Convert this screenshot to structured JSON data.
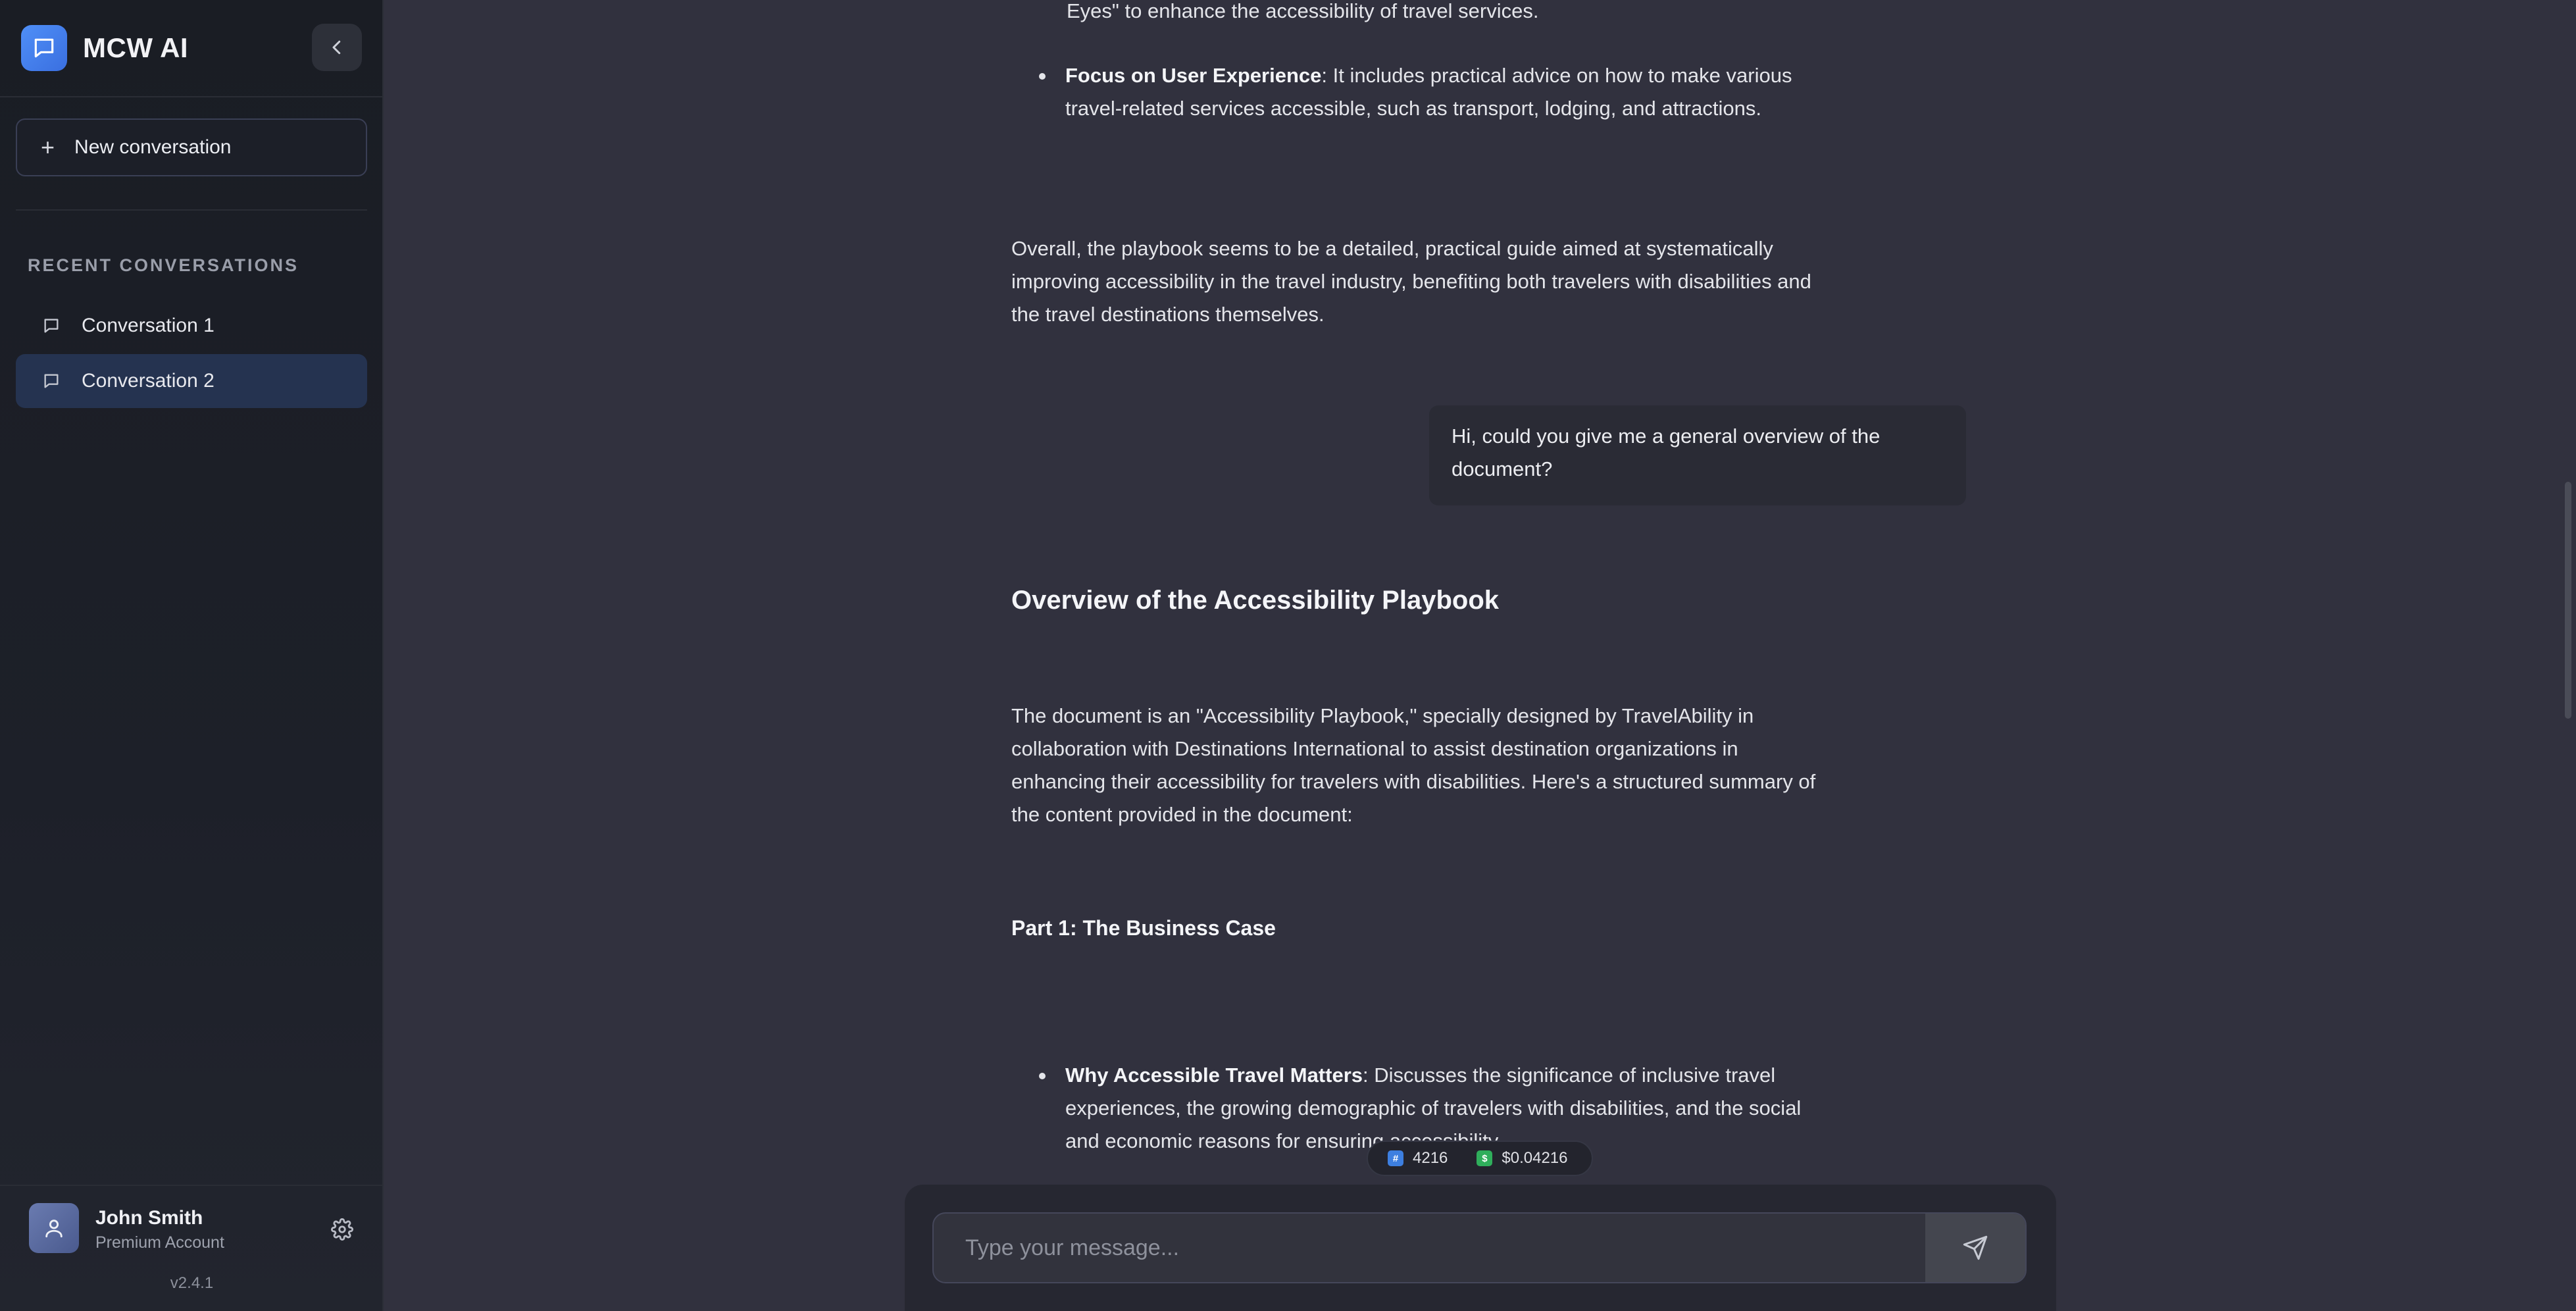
{
  "app": {
    "title": "MCW AI",
    "version": "v2.4.1"
  },
  "sidebar": {
    "new_conversation_label": "New conversation",
    "recent_heading": "RECENT CONVERSATIONS",
    "conversations": [
      {
        "label": "Conversation 1",
        "active": false
      },
      {
        "label": "Conversation 2",
        "active": true
      }
    ],
    "user": {
      "name": "John Smith",
      "plan": "Premium Account"
    }
  },
  "chat": {
    "prev_para_tail": "Eyes\" to enhance the accessibility of travel services.",
    "prev_bullet": {
      "bold": "Focus on User Experience",
      "rest": ": It includes practical advice on how to make various travel-related services accessible, such as transport, lodging, and attractions."
    },
    "prev_summary": "Overall, the playbook seems to be a detailed, practical guide aimed at systematically improving accessibility in the travel industry, benefiting both travelers with disabilities and the travel destinations themselves.",
    "user_message": "Hi, could you give me a general overview of the document?",
    "response": {
      "heading": "Overview of the Accessibility Playbook",
      "intro": "The document is an \"Accessibility Playbook,\" specially designed by TravelAbility in collaboration with Destinations International to assist destination organizations in enhancing their accessibility for travelers with disabilities. Here's a structured summary of the content provided in the document:",
      "part1_heading": "Part 1: The Business Case",
      "bullet1": {
        "bold": "Why Accessible Travel Matters",
        "rest": ": Discusses the significance of inclusive travel experiences, the growing demographic of travelers with disabilities, and the social and economic reasons for ensuring accessibility."
      }
    }
  },
  "usage": {
    "tokens": "4216",
    "cost": "$0.04216",
    "tokens_icon": "hash-icon",
    "cost_icon": "money-icon"
  },
  "composer": {
    "placeholder": "Type your message..."
  },
  "colors": {
    "accent": "#4f8ff7",
    "active_item": "#253350",
    "main_bg": "#31313e",
    "sidebar_bg": "#1a1d24"
  }
}
